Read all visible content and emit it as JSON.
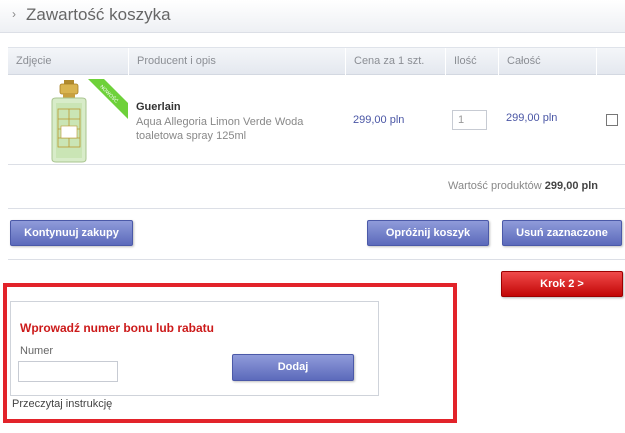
{
  "page": {
    "title": "Zawartość koszyka"
  },
  "table": {
    "headers": [
      "Zdjęcie",
      "Producent i opis",
      "Cena za 1 szt.",
      "Ilość",
      "Całość"
    ],
    "items": [
      {
        "badge": "NOWOŚĆ",
        "brand": "Guerlain",
        "description": "Aqua Allegoria Limon Verde Woda toaletowa spray 125ml",
        "price": "299,00 pln",
        "quantity": "1",
        "total": "299,00 pln",
        "checked": false
      }
    ]
  },
  "summary": {
    "label": "Wartość produktów",
    "value": "299,00 pln"
  },
  "buttons": {
    "continue": "Kontynuuj zakupy",
    "empty": "Opróżnij koszyk",
    "remove_selected": "Usuń zaznaczone",
    "next_step": "Krok 2  >"
  },
  "voucher": {
    "title": "Wprowadź numer bonu lub rabatu",
    "number_label": "Numer",
    "number_value": "",
    "add_button": "Dodaj",
    "instructions_link": "Przeczytaj instrukcję"
  },
  "colors": {
    "accent_blue": "#5c6abb",
    "accent_red": "#c20606",
    "highlight_border": "#e2232a",
    "price_text": "#4a56a5",
    "badge_green": "#6ed13a"
  },
  "icons": {
    "title_bullet": "chevron-right-icon"
  }
}
